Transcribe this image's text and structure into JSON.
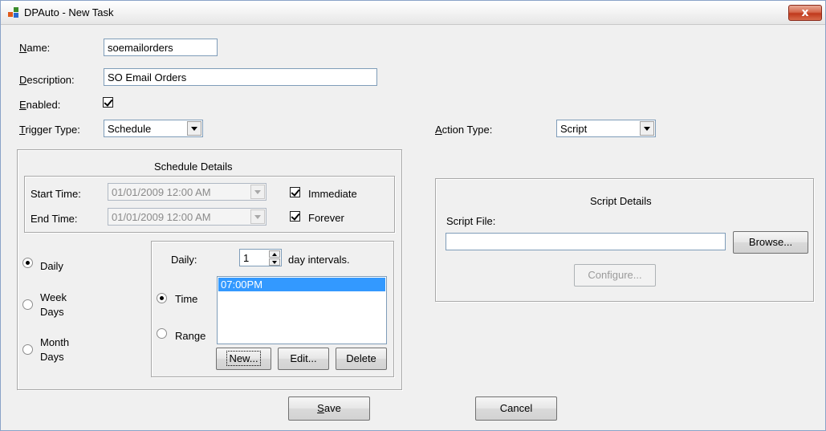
{
  "window": {
    "title": "DPAuto - New Task",
    "close_label": "x",
    "icon": "app-icon"
  },
  "form": {
    "name_label": "Name:",
    "name_value": "soemailorders",
    "description_label": "Description:",
    "description_value": "SO Email Orders",
    "enabled_label": "Enabled:",
    "enabled_checked": true,
    "trigger_type_label": "Trigger Type:",
    "trigger_type_value": "Schedule",
    "action_type_label": "Action Type:",
    "action_type_value": "Script"
  },
  "schedule": {
    "title": "Schedule Details",
    "start_time_label": "Start Time:",
    "start_time_value": "01/01/2009 12:00 AM",
    "end_time_label": "End Time:",
    "end_time_value": "01/01/2009 12:00 AM",
    "immediate_label": "Immediate",
    "immediate_checked": true,
    "forever_label": "Forever",
    "forever_checked": true,
    "frequency": [
      {
        "label": "Daily",
        "selected": true
      },
      {
        "label_line1": "Week",
        "label_line2": "Days",
        "selected": false
      },
      {
        "label_line1": "Month",
        "label_line2": "Days",
        "selected": false
      }
    ],
    "daily": {
      "label": "Daily:",
      "interval_value": "1",
      "interval_suffix": "day intervals.",
      "time_label": "Time",
      "time_selected": true,
      "range_label": "Range",
      "range_selected": false,
      "times": [
        "07:00PM"
      ],
      "new_label": "New...",
      "edit_label": "Edit...",
      "delete_label": "Delete"
    }
  },
  "script": {
    "title": "Script Details",
    "file_label": "Script File:",
    "file_value": "",
    "browse_label": "Browse...",
    "configure_label": "Configure..."
  },
  "footer": {
    "save_label": "Save",
    "cancel_label": "Cancel"
  },
  "colors": {
    "dialog_bg": "#f0f0f0",
    "selection": "#3399ff",
    "close_button": "#c0391c"
  }
}
